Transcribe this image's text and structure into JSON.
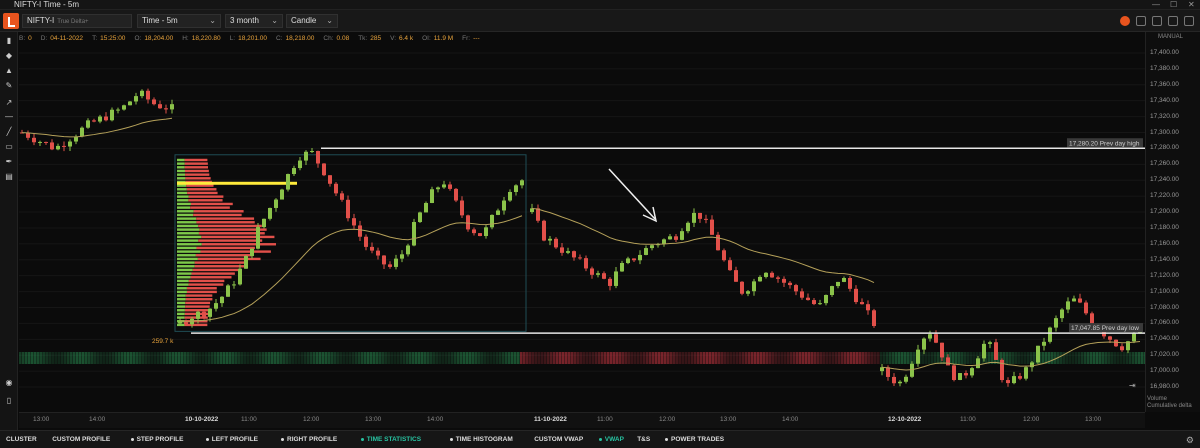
{
  "window": {
    "title": "NIFTY-I Time - 5m"
  },
  "toolbar": {
    "symbol": "NIFTY-I",
    "symbol_sub": "True Delta+",
    "timeframe": "Time - 5m",
    "range": "3 month",
    "chart_type": "Candle"
  },
  "infobar": [
    {
      "k": "B:",
      "v": "0"
    },
    {
      "k": "D:",
      "v": "04-11-2022"
    },
    {
      "k": "T:",
      "v": "15:25:00"
    },
    {
      "k": "O:",
      "v": "18,204.00"
    },
    {
      "k": "H:",
      "v": "18,220.80"
    },
    {
      "k": "L:",
      "v": "18,201.00"
    },
    {
      "k": "C:",
      "v": "18,218.00"
    },
    {
      "k": "Ch:",
      "v": "0.08"
    },
    {
      "k": "Tk:",
      "v": "285"
    },
    {
      "k": "V:",
      "v": "6.4 k"
    },
    {
      "k": "OI:",
      "v": "11.9 M"
    },
    {
      "k": "Fr:",
      "v": "---"
    }
  ],
  "axis": {
    "mode": "MANUAL",
    "prices": [
      "17,400.00",
      "17,380.00",
      "17,360.00",
      "17,340.00",
      "17,320.00",
      "17,300.00",
      "17,280.00",
      "17,260.00",
      "17,240.00",
      "17,220.00",
      "17,200.00",
      "17,180.00",
      "17,160.00",
      "17,140.00",
      "17,120.00",
      "17,100.00",
      "17,080.00",
      "17,060.00",
      "17,040.00",
      "17,020.00",
      "17,000.00",
      "16,980.00"
    ]
  },
  "annotations": {
    "prev_day_high": "17,280.20 Prev day high",
    "prev_day_low": "17,047.85 Prev day low",
    "profile_volume": "259.7 k"
  },
  "time_axis": {
    "labels": [
      {
        "text": "13:00",
        "date": false
      },
      {
        "text": "14:00",
        "date": false
      },
      {
        "text": "10-10-2022",
        "date": true
      },
      {
        "text": "11:00",
        "date": false
      },
      {
        "text": "12:00",
        "date": false
      },
      {
        "text": "13:00",
        "date": false
      },
      {
        "text": "14:00",
        "date": false
      },
      {
        "text": "11-10-2022",
        "date": true
      },
      {
        "text": "11:00",
        "date": false
      },
      {
        "text": "12:00",
        "date": false
      },
      {
        "text": "13:00",
        "date": false
      },
      {
        "text": "14:00",
        "date": false
      },
      {
        "text": "12-10-2022",
        "date": true
      },
      {
        "text": "11:00",
        "date": false
      },
      {
        "text": "12:00",
        "date": false
      },
      {
        "text": "13:00",
        "date": false
      }
    ]
  },
  "volume_panel": {
    "name1": "Volume",
    "name2": "Cumulative delta"
  },
  "bottom_tabs": [
    {
      "label": "CLUSTER",
      "dot": false,
      "active": false
    },
    {
      "label": "CUSTOM PROFILE",
      "dot": false,
      "active": false
    },
    {
      "label": "STEP PROFILE",
      "dot": true,
      "active": false
    },
    {
      "label": "LEFT PROFILE",
      "dot": true,
      "active": false
    },
    {
      "label": "RIGHT PROFILE",
      "dot": true,
      "active": false
    },
    {
      "label": "TIME STATISTICS",
      "dot": true,
      "active": true
    },
    {
      "label": "TIME HISTOGRAM",
      "dot": true,
      "active": false
    },
    {
      "label": "CUSTOM VWAP",
      "dot": false,
      "active": false
    },
    {
      "label": "VWAP",
      "dot": true,
      "active": true
    },
    {
      "label": "T&S",
      "dot": false,
      "active": false
    },
    {
      "label": "POWER TRADES",
      "dot": true,
      "active": false
    }
  ],
  "colors": {
    "bull": "#8bc34a",
    "bear": "#e2504a",
    "vwap": "#b5a15a",
    "accent": "#e8541e",
    "active": "#28c3a2",
    "poc": "#ffeb3b"
  },
  "chart_data": {
    "type": "candlestick",
    "ylim": [
      16970,
      17410
    ],
    "hlines": [
      {
        "label": "17,280.20 Prev day high",
        "y": 17280.2
      },
      {
        "label": "17,047.85 Prev day low",
        "y": 17047.85
      }
    ],
    "segments": [
      {
        "name": "",
        "path": [
          17300,
          17290,
          17280,
          17295,
          17310,
          17320,
          17330,
          17350,
          17335,
          17330
        ]
      },
      {
        "name": "",
        "path": [
          17060,
          17070,
          17075,
          17090,
          17110,
          17140,
          17180,
          17210,
          17240,
          17270,
          17275,
          17250,
          17220,
          17190,
          17160,
          17140,
          17130,
          17150,
          17190,
          17220,
          17240,
          17210,
          17180,
          17170,
          17200,
          17230,
          17240
        ]
      },
      {
        "name": "",
        "path": [
          17200,
          17170,
          17160,
          17150,
          17140,
          17130,
          17120,
          17110,
          17130,
          17140,
          17150,
          17160,
          17165,
          17170,
          17190,
          17200,
          17180,
          17150,
          17120,
          17100,
          17110,
          17130,
          17120,
          17110,
          17100,
          17090,
          17080,
          17100,
          17120,
          17100,
          17080,
          17060
        ]
      },
      {
        "name": "",
        "path": [
          17000,
          16990,
          16985,
          17010,
          17040,
          17050,
          17030,
          17000,
          16990,
          17000,
          17020,
          17040,
          17010,
          16980,
          16990,
          17000,
          17020,
          17040,
          17060,
          17080,
          17090,
          17080,
          17060,
          17050,
          17040,
          17030,
          17040,
          17050
        ]
      }
    ]
  }
}
